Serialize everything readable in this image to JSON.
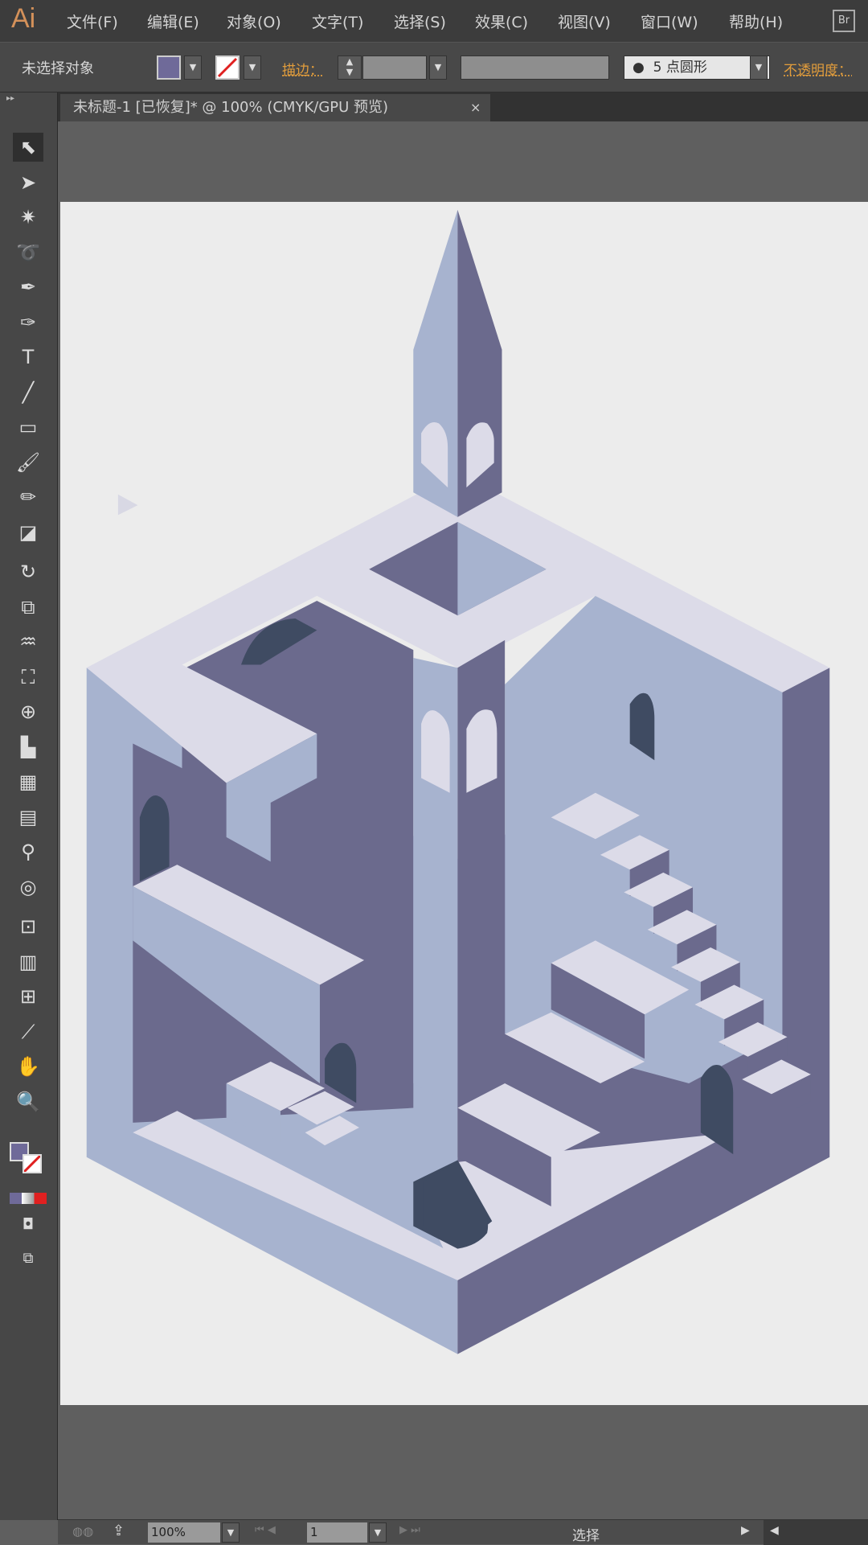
{
  "app": {
    "logo": "Ai",
    "bridge": "Br"
  },
  "menu": [
    "文件(F)",
    "编辑(E)",
    "对象(O)",
    "文字(T)",
    "选择(S)",
    "效果(C)",
    "视图(V)",
    "窗口(W)",
    "帮助(H)"
  ],
  "control": {
    "selection_status": "未选择对象",
    "fill_color": "#6f6a99",
    "stroke": "none",
    "stroke_label": "描边：",
    "brush_dot": "●",
    "brush_size": "5",
    "brush_label": "点圆形",
    "opacity_label": "不透明度："
  },
  "document_tab": {
    "title": "未标题-1 [已恢复]* @ 100% (CMYK/GPU 预览)",
    "close": "×"
  },
  "tools": [
    {
      "name": "selection-tool",
      "glyph": "⬉"
    },
    {
      "name": "direct-selection-tool",
      "glyph": "➤"
    },
    {
      "name": "magic-wand-tool",
      "glyph": "✷"
    },
    {
      "name": "lasso-tool",
      "glyph": "➰"
    },
    {
      "name": "pen-tool",
      "glyph": "✒"
    },
    {
      "name": "curvature-tool",
      "glyph": "✑"
    },
    {
      "name": "type-tool",
      "glyph": "T"
    },
    {
      "name": "line-tool",
      "glyph": "╱"
    },
    {
      "name": "rectangle-tool",
      "glyph": "▭"
    },
    {
      "name": "paintbrush-tool",
      "glyph": "🖌"
    },
    {
      "name": "pencil-tool",
      "glyph": "✏"
    },
    {
      "name": "eraser-tool",
      "glyph": "◪"
    },
    {
      "name": "rotate-tool",
      "glyph": "↻"
    },
    {
      "name": "scale-tool",
      "glyph": "⧉"
    },
    {
      "name": "warp-tool",
      "glyph": "♒"
    },
    {
      "name": "free-transform-tool",
      "glyph": "⛶"
    },
    {
      "name": "shape-builder-tool",
      "glyph": "⊕"
    },
    {
      "name": "perspective-grid-tool",
      "glyph": "▙"
    },
    {
      "name": "mesh-tool",
      "glyph": "▦"
    },
    {
      "name": "gradient-tool",
      "glyph": "▤"
    },
    {
      "name": "eyedropper-tool",
      "glyph": "⚲"
    },
    {
      "name": "blend-tool",
      "glyph": "◎"
    },
    {
      "name": "symbol-sprayer-tool",
      "glyph": "⊡"
    },
    {
      "name": "column-graph-tool",
      "glyph": "▥"
    },
    {
      "name": "artboard-tool",
      "glyph": "⊞"
    },
    {
      "name": "slice-tool",
      "glyph": "⟋"
    },
    {
      "name": "hand-tool",
      "glyph": "✋"
    },
    {
      "name": "zoom-tool",
      "glyph": "🔍"
    }
  ],
  "colors": {
    "top": "#dcdbe8",
    "light": "#a7b3cf",
    "dark": "#6b6a8d",
    "darkest": "#3f4b62",
    "artboard": "#ececec"
  },
  "status": {
    "zoom": "100%",
    "page": "1",
    "mode": "选择"
  }
}
